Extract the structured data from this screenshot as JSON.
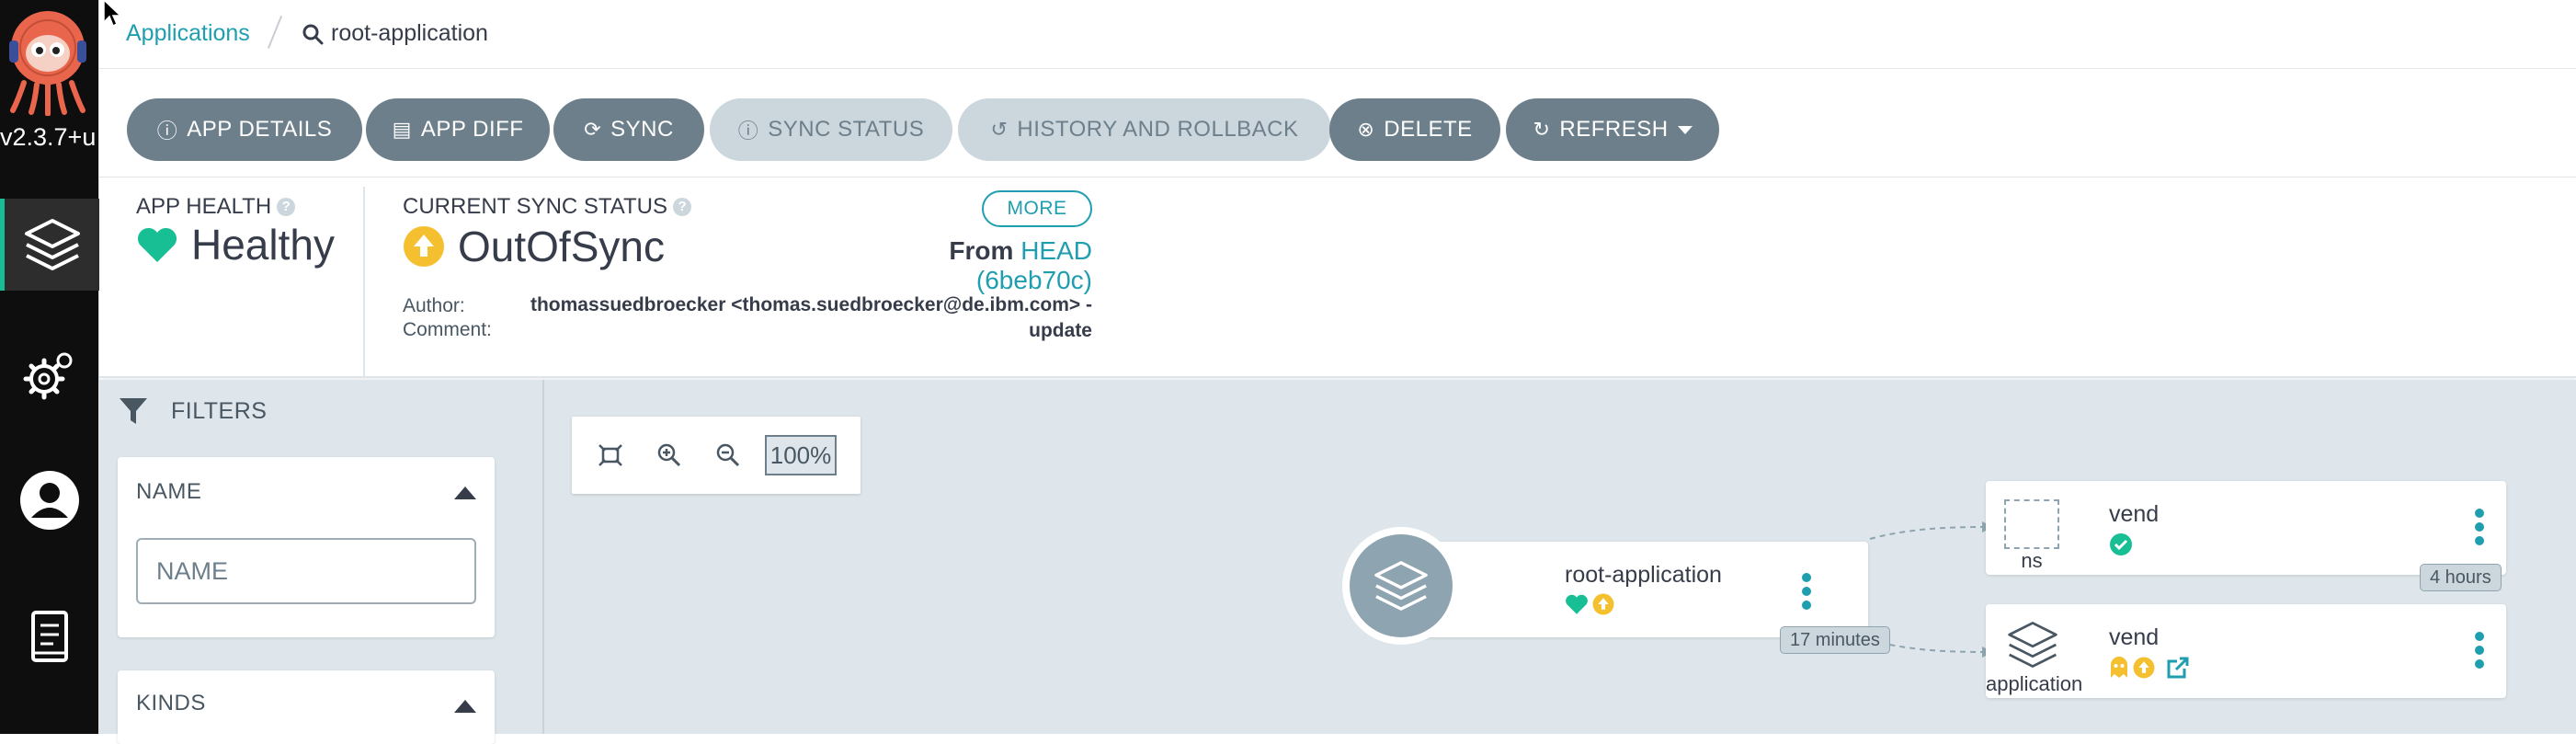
{
  "sidebar": {
    "version": "v2.3.7+u",
    "items": [
      {
        "icon": "layers-icon"
      },
      {
        "icon": "gear-icon"
      },
      {
        "icon": "user-icon"
      },
      {
        "icon": "docs-icon"
      }
    ]
  },
  "breadcrumb": {
    "root": "Applications",
    "current": "root-application"
  },
  "toolbar": {
    "app_details": "APP DETAILS",
    "app_diff": "APP DIFF",
    "sync": "SYNC",
    "sync_status": "SYNC STATUS",
    "history": "HISTORY AND ROLLBACK",
    "delete": "DELETE",
    "refresh": "REFRESH"
  },
  "summary": {
    "health_label": "APP HEALTH",
    "health_value": "Healthy",
    "sync_label": "CURRENT SYNC STATUS",
    "sync_value": "OutOfSync",
    "more": "MORE",
    "from_prefix": "From",
    "revision": "HEAD (6beb70c)",
    "author_label": "Author:",
    "comment_label": "Comment:",
    "author_value": "thomassuedbroecker <thomas.suedbroecker@de.ibm.com> -",
    "comment_value": "update"
  },
  "filters": {
    "title": "FILTERS",
    "name_title": "NAME",
    "name_placeholder": "NAME",
    "kinds_title": "KINDS"
  },
  "zoom": {
    "level": "100%"
  },
  "graph": {
    "root": {
      "name": "root-application",
      "age": "17 minutes"
    },
    "ns": {
      "name": "vend",
      "kind": "ns",
      "age": "4 hours"
    },
    "app": {
      "name": "vend",
      "kind": "application"
    }
  },
  "colors": {
    "accent": "#1f9eaf",
    "healthy": "#18be94",
    "outofsync": "#f4c030",
    "button": "#6d7f8b",
    "button_disabled": "#ccd6dd"
  }
}
